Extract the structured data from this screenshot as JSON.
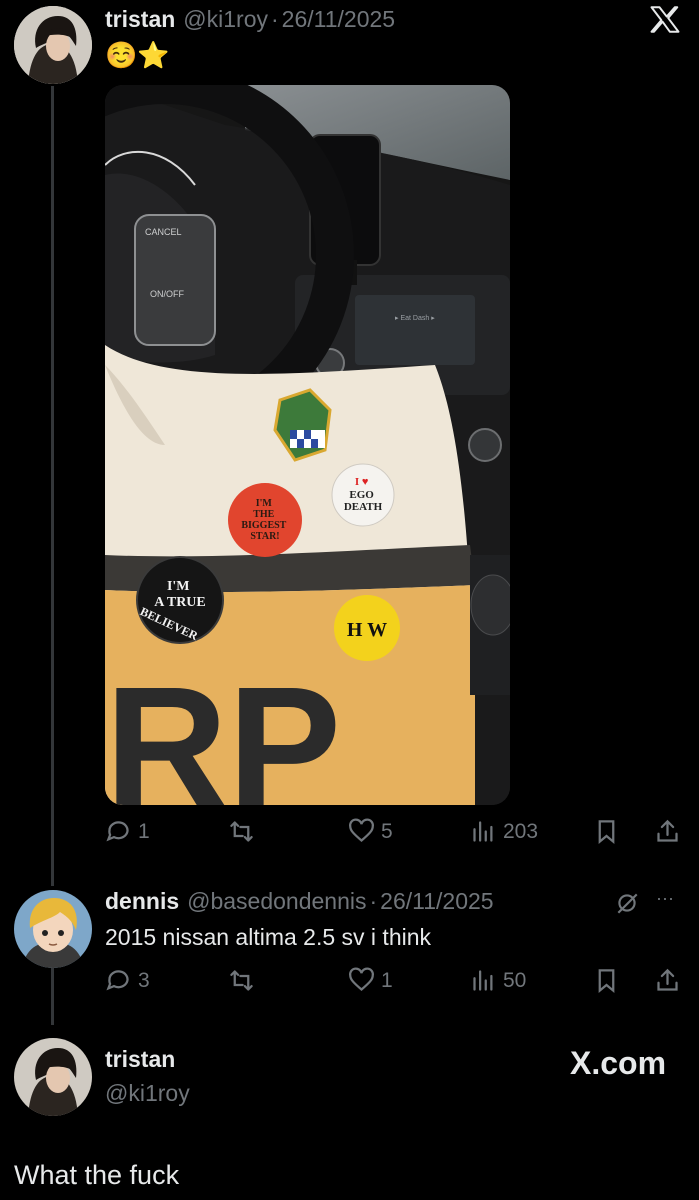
{
  "post": {
    "name": "tristan",
    "handle": "@ki1roy",
    "sep": "·",
    "date": "26/11/2025",
    "text": "☺️⭐",
    "media": {
      "pin_red_lines": [
        "I'M",
        "THE",
        "BIGGEST",
        "STAR!"
      ],
      "pin_ego_lines": [
        "I ♥",
        "EGO",
        "DEATH"
      ],
      "pin_black_top": "I'M",
      "pin_black_mid": "A TRUE",
      "pin_black_arc": "BELIEVER",
      "pin_yellow": "H W",
      "bag_letters": "RP",
      "steering_cancel": "CANCEL",
      "steering_onoff": "ON/OFF"
    },
    "actions": {
      "replies": "1",
      "reposts": "",
      "likes": "5",
      "views": "203"
    }
  },
  "reply": {
    "name": "dennis",
    "handle": "@basedondennis",
    "sep": "·",
    "date": "26/11/2025",
    "text": "2015 nissan altima 2.5 sv i think",
    "more": "···",
    "actions": {
      "replies": "3",
      "reposts": "",
      "likes": "1",
      "views": "50"
    }
  },
  "quote": {
    "name": "tristan",
    "handle": "@ki1roy",
    "text": "What the fuck",
    "watermark": "X.com"
  },
  "colors": {
    "bg": "#000000",
    "text": "#e7e9ea",
    "muted": "#71767b",
    "line": "#333639"
  }
}
